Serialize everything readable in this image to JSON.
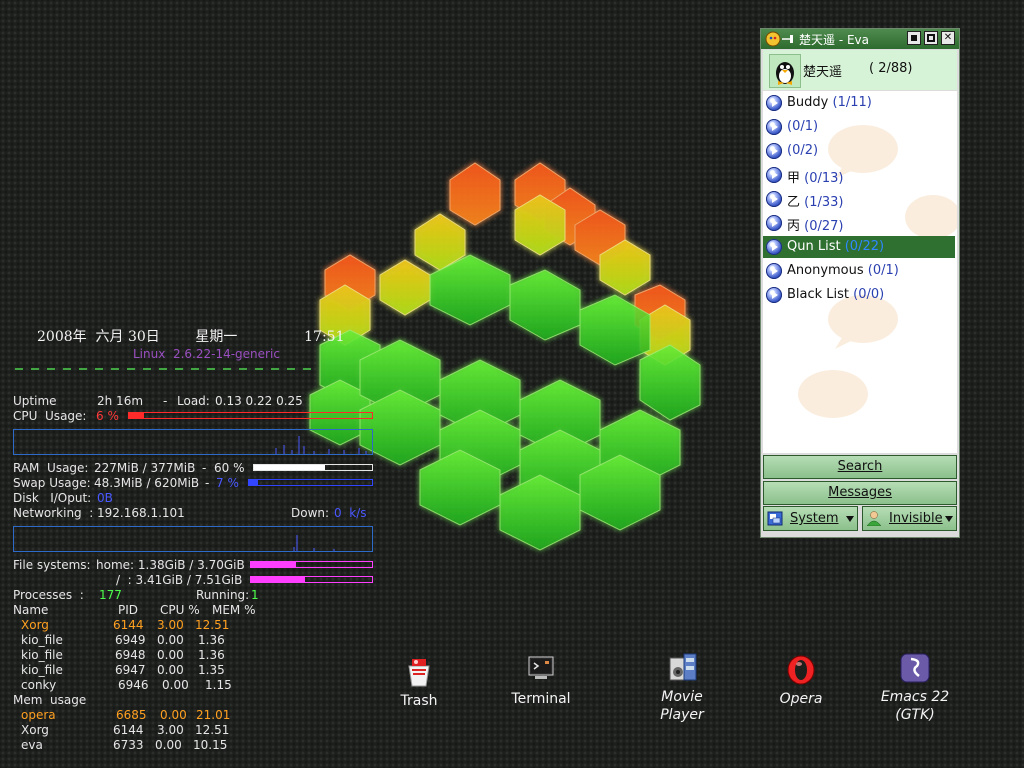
{
  "conky": {
    "date_text": "2008年  六月 30日        星期一               17:51",
    "kernel": "Linux  2.6.22-14-generic",
    "uptime_label": "Uptime",
    "uptime_value": "2h 16m",
    "load_label": "Load:",
    "load_value": "0.13 0.22 0.25",
    "cpu_label": "CPU  Usage:",
    "cpu_value": "6 %",
    "cpu_percent": 6,
    "ram_label": "RAM  Usage:",
    "ram_value": "227MiB / 377MiB",
    "ram_pct_text": "60 %",
    "ram_percent": 60,
    "swap_label": "Swap Usage:",
    "swap_value": "48.3MiB / 620MiB",
    "swap_pct_text": "7 %",
    "swap_percent": 7,
    "disk_label": "Disk   I/Oput:",
    "disk_value": "0B",
    "net_label": "Networking  :",
    "net_ip": "192.168.1.101",
    "down_label": "Down:",
    "down_value": "0  k/s",
    "fs_label": "File systems:",
    "fs_home": "home: 1.38GiB / 3.70GiB",
    "fs_home_percent": 37,
    "fs_root": "/  : 3.41GiB / 7.51GiB",
    "fs_root_percent": 45,
    "processes_label": "Processes  :",
    "processes_value": "177",
    "running_label": "Running:",
    "running_value": "1",
    "proc_headers": [
      "Name",
      "PID",
      "CPU %",
      "MEM %"
    ],
    "cpu_top": [
      {
        "name": "Xorg",
        "pid": "6144",
        "cpu": "3.00",
        "mem": "12.51"
      },
      {
        "name": "kio_file",
        "pid": "6949",
        "cpu": "0.00",
        "mem": "1.36"
      },
      {
        "name": "kio_file",
        "pid": "6948",
        "cpu": "0.00",
        "mem": "1.36"
      },
      {
        "name": "kio_file",
        "pid": "6947",
        "cpu": "0.00",
        "mem": "1.35"
      },
      {
        "name": "conky",
        "pid": "6946",
        "cpu": "0.00",
        "mem": "1.15"
      }
    ],
    "mem_label": "Mem  usage",
    "mem_top": [
      {
        "name": "opera",
        "pid": "6685",
        "cpu": "0.00",
        "mem": "21.01"
      },
      {
        "name": "Xorg",
        "pid": "6144",
        "cpu": "3.00",
        "mem": "12.51"
      },
      {
        "name": "eva",
        "pid": "6733",
        "cpu": "0.00",
        "mem": "10.15"
      }
    ],
    "colors": {
      "text": "#e6e6e6",
      "purple": "#9a4fc0",
      "red": "#ff3a3a",
      "blue": "#4a58ff",
      "green": "#4cff4c",
      "orange": "#ffa020",
      "magenta": "#ff3fff"
    }
  },
  "eva": {
    "title": "楚天遥 - Eva",
    "user_name": "楚天遥",
    "user_count": "( 2/88)",
    "groups": [
      {
        "label": "Buddy",
        "count": "(1/11)",
        "selected": false
      },
      {
        "label": "",
        "count": "(0/1)",
        "selected": false
      },
      {
        "label": "",
        "count": "(0/2)",
        "selected": false
      },
      {
        "label": "甲",
        "count": "(0/13)",
        "selected": false
      },
      {
        "label": "乙",
        "count": "(1/33)",
        "selected": false
      },
      {
        "label": "丙",
        "count": "(0/27)",
        "selected": false
      },
      {
        "label": "Qun List",
        "count": "(0/22)",
        "selected": true
      },
      {
        "label": "Anonymous",
        "count": "(0/1)",
        "selected": false
      },
      {
        "label": "Black List",
        "count": "(0/0)",
        "selected": false
      }
    ],
    "search_label": "Search",
    "messages_label": "Messages",
    "system_label": "System",
    "status_label": "Invisible"
  },
  "desktop": {
    "icons": [
      {
        "name": "Trash",
        "icon": "trash-icon"
      },
      {
        "name": "Terminal",
        "icon": "terminal-icon"
      },
      {
        "name": "Movie\nPlayer",
        "icon": "movie-player-icon"
      },
      {
        "name": "Opera",
        "icon": "opera-icon"
      },
      {
        "name": "Emacs 22\n(GTK)",
        "icon": "emacs-icon"
      }
    ]
  }
}
